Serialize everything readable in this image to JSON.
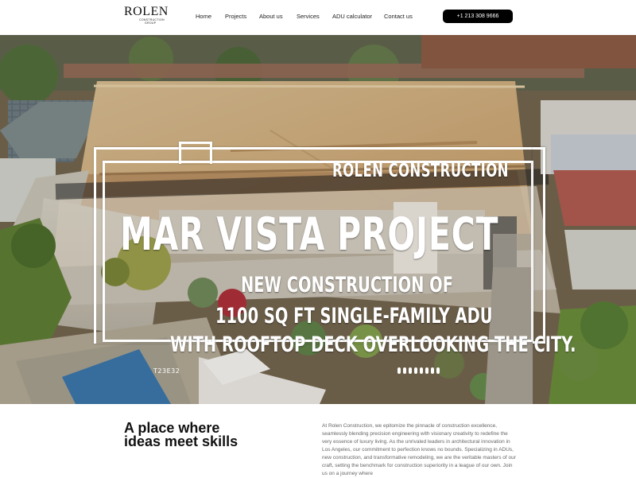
{
  "nav": {
    "logo_main": "ROLEN",
    "logo_sub_1": "CONSTRUCTION",
    "logo_sub_2": "GROUP",
    "items": [
      "Home",
      "Projects",
      "About us",
      "Services",
      "ADU calculator",
      "Contact us"
    ],
    "phone": "+1 213 308 9666"
  },
  "hero": {
    "brand": "ROLEN CONSTRUCTION",
    "title": "MAR VISTA PROJECT",
    "line1": "NEW CONSTRUCTION OF",
    "line2": "1100 SQ FT SINGLE-FAMILY ADU",
    "line3": "WITH ROOFTOP DECK OVERLOOKING THE CITY.",
    "id": "T23E32"
  },
  "content": {
    "tagline": "A place where ideas meet skills",
    "about": "At Rolen Construction, we epitomize the pinnacle of construction excellence, seamlessly blending precision engineering with visionary creativity to redefine the very essence of luxury living. As the unrivaled leaders in architectural innovation in Los Angeles, our commitment to perfection knows no bounds. Specializing in ADUs, new construction, and transformative remodeling, we are the veritable masters of our craft, setting the benchmark for construction superiority in a league of our own. Join us on a journey where"
  },
  "colors": {
    "nav_bg": "#ffffff",
    "phone_bg": "#000000",
    "hero_text": "#ffffff"
  }
}
